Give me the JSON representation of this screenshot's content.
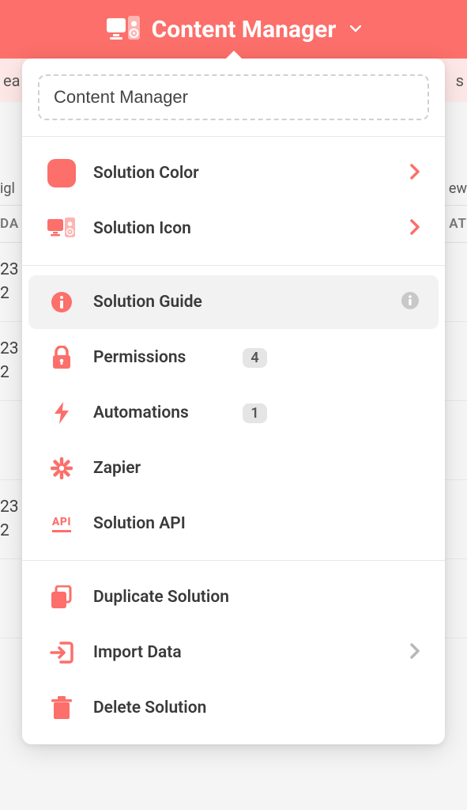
{
  "header": {
    "title": "Content Manager"
  },
  "background": {
    "tab_left": "ea",
    "tab_right": "s",
    "label_left": "igl",
    "label_right": "ew",
    "th_left": "DA",
    "th_right": "AT",
    "cell_line1": "23",
    "cell_line2": "2"
  },
  "dropdown": {
    "input_value": "Content Manager",
    "sections": [
      {
        "items": [
          {
            "id": "solution-color",
            "label": "Solution Color",
            "icon": "color-swatch",
            "chevron": true
          },
          {
            "id": "solution-icon",
            "label": "Solution Icon",
            "icon": "devices",
            "chevron": true
          }
        ]
      },
      {
        "items": [
          {
            "id": "solution-guide",
            "label": "Solution Guide",
            "icon": "info-filled",
            "info_right": true,
            "highlighted": true
          },
          {
            "id": "permissions",
            "label": "Permissions",
            "icon": "lock",
            "badge": "4"
          },
          {
            "id": "automations",
            "label": "Automations",
            "icon": "bolt",
            "badge": "1"
          },
          {
            "id": "zapier",
            "label": "Zapier",
            "icon": "asterisk"
          },
          {
            "id": "solution-api",
            "label": "Solution API",
            "icon": "api"
          }
        ]
      },
      {
        "items": [
          {
            "id": "duplicate",
            "label": "Duplicate Solution",
            "icon": "duplicate"
          },
          {
            "id": "import",
            "label": "Import Data",
            "icon": "import",
            "chevron": true,
            "chevron_gray": true
          },
          {
            "id": "delete",
            "label": "Delete Solution",
            "icon": "trash"
          }
        ]
      }
    ]
  }
}
